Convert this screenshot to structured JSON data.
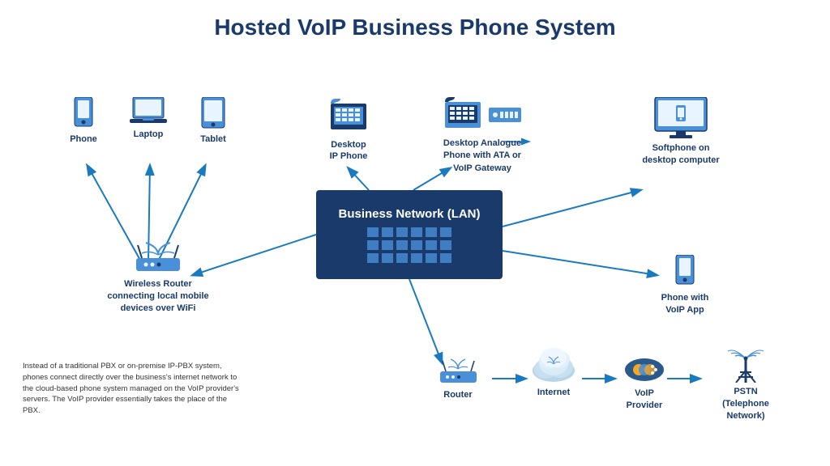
{
  "title": "Hosted VoIP Business Phone System",
  "nodes": {
    "phone": {
      "label": "Phone"
    },
    "laptop": {
      "label": "Laptop"
    },
    "tablet": {
      "label": "Tablet"
    },
    "desktop_ip": {
      "label": "Desktop\nIP Phone"
    },
    "desktop_analogue": {
      "label": "Desktop Analogue\nPhone with ATA or\nVoIP Gateway"
    },
    "softphone": {
      "label": "Softphone on\ndesktop computer"
    },
    "wireless_router": {
      "label": "Wireless Router\nconnecting local mobile\ndevices over WiFi"
    },
    "business_network": {
      "label": "Business Network (LAN)"
    },
    "phone_voip": {
      "label": "Phone with\nVoIP App"
    },
    "router": {
      "label": "Router"
    },
    "internet": {
      "label": "Internet"
    },
    "voip_provider": {
      "label": "VoIP\nProvider"
    },
    "pstn": {
      "label": "PSTN\n(Telephone\nNetwork)"
    }
  },
  "info_text": "Instead of a traditional PBX or on-premise IP-PBX system, phones connect directly over the business's internet network to the cloud-based phone system managed on the VoIP provider's servers. The VoIP provider essentially takes the place of the PBX."
}
